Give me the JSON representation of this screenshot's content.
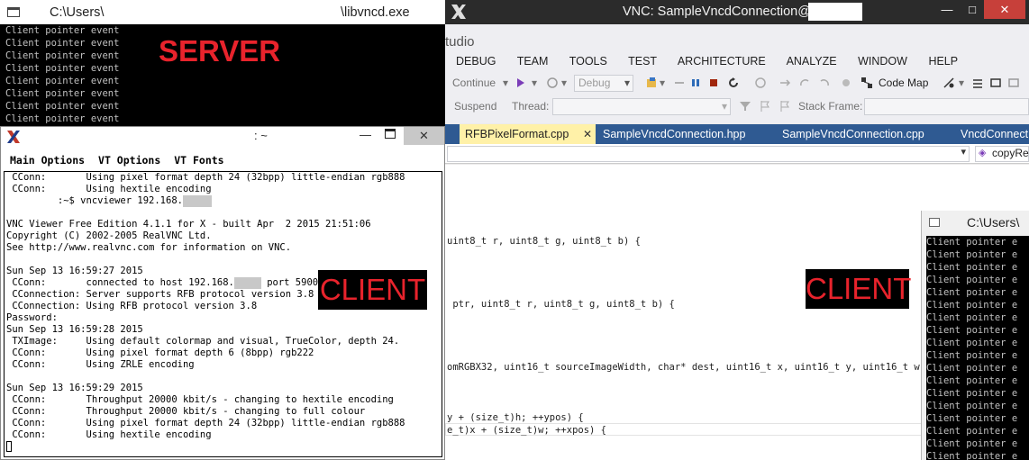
{
  "server": {
    "title_left": "C:\\Users\\",
    "title_right": "\\libvncd.exe",
    "lines": [
      "Client pointer event",
      "Client pointer event",
      "Client pointer event",
      "Client pointer event",
      "Client pointer event",
      "Client pointer event",
      "Client pointer event",
      "Client pointer event"
    ],
    "label": "SERVER",
    "label_color": "#e8232c"
  },
  "xterm": {
    "title": ": ~",
    "close_glyph": "✕",
    "menu": [
      "Main Options",
      "VT Options",
      "VT Fonts"
    ],
    "lines": [
      " CConn:       Using pixel format depth 24 (32bpp) little-endian rgb888",
      " CConn:       Using hextile encoding",
      "         :~$ vncviewer 192.168.",
      "",
      "VNC Viewer Free Edition 4.1.1 for X - built Apr  2 2015 21:51:06",
      "Copyright (C) 2002-2005 RealVNC Ltd.",
      "See http://www.realvnc.com for information on VNC.",
      "",
      "Sun Sep 13 16:59:27 2015",
      " CConn:       connected to host 192.168.",
      " CConnection: Server supports RFB protocol version 3.8",
      " CConnection: Using RFB protocol version 3.8",
      "Password:",
      "Sun Sep 13 16:59:28 2015",
      " TXImage:     Using default colormap and visual, TrueColor, depth 24.",
      " CConn:       Using pixel format depth 6 (8bpp) rgb222",
      " CConn:       Using ZRLE encoding",
      "",
      "Sun Sep 13 16:59:29 2015",
      " CConn:       Throughput 20000 kbit/s - changing to hextile encoding",
      " CConn:       Throughput 20000 kbit/s - changing to full colour",
      " CConn:       Using pixel format depth 24 (32bpp) little-endian rgb888",
      " CConn:       Using hextile encoding"
    ],
    "port_suffix": " port 5900",
    "client_label": "CLIENT"
  },
  "vnc": {
    "title": "VNC: SampleVncdConnection@",
    "min_glyph": "—",
    "max_glyph": "□",
    "close_glyph": "✕",
    "vs": {
      "app_name": "tudio",
      "menu": [
        "DEBUG",
        "TEAM",
        "TOOLS",
        "TEST",
        "ARCHITECTURE",
        "ANALYZE",
        "WINDOW",
        "HELP"
      ],
      "toolbar": {
        "continue_label": "Continue",
        "config_value": "Debug",
        "code_map_label": "Code Map",
        "suspend_label": "Suspend",
        "thread_label": "Thread:",
        "stack_frame_label": "Stack Frame:"
      },
      "tabs": [
        "RFBPixelFormat.cpp",
        "SampleVncdConnection.hpp",
        "SampleVncdConnection.cpp",
        "VncdConnect"
      ],
      "tab_close_glyph": "✕",
      "nav_member": "copyRe",
      "code": {
        "line1": "uint8_t r, uint8_t g, uint8_t b) {",
        "line2": " ptr, uint8_t r, uint8_t g, uint8_t b) {",
        "line3": "omRGBX32, uint16_t sourceImageWidth, char* dest, uint16_t x, uint16_t y, uint16_t w, uin",
        "line4": "y + (size_t)h; ++ypos) {",
        "line5": "e_t)x + (size_t)w; ++xpos) {"
      },
      "client_label": "CLIENT"
    },
    "inner_cmd": {
      "title": "C:\\Users\\",
      "lines": [
        "Client pointer e",
        "Client pointer e",
        "Client pointer e",
        "Client pointer e",
        "Client pointer e",
        "Client pointer e",
        "Client pointer e",
        "Client pointer e",
        "Client pointer e",
        "Client pointer e",
        "Client pointer e",
        "Client pointer e",
        "Client pointer e",
        "Client pointer e",
        "Client pointer e",
        "Client pointer e",
        "Client pointer e",
        "Client pointer e"
      ]
    }
  }
}
